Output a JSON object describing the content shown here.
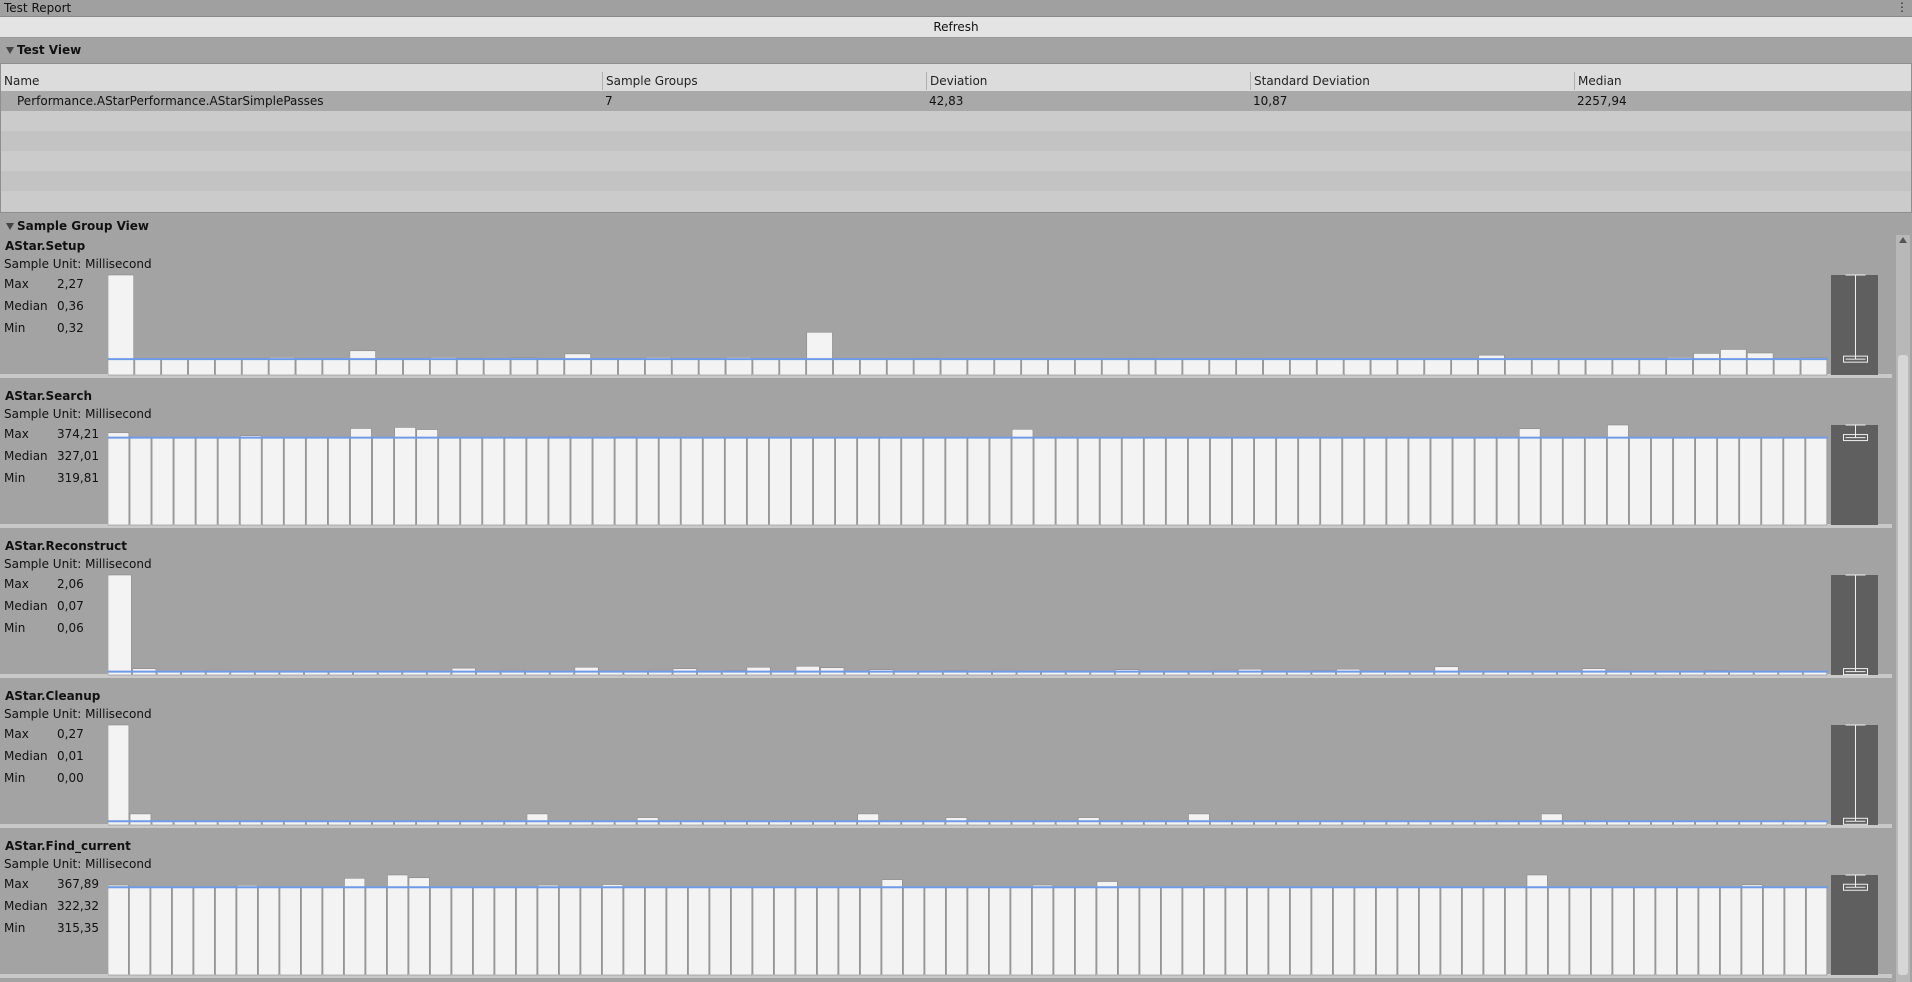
{
  "window": {
    "title": "Test Report",
    "menu_glyph": "⋮"
  },
  "toolbar": {
    "refresh_label": "Refresh"
  },
  "test_view": {
    "header": "Test View",
    "columns": [
      "Name",
      "Sample Groups",
      "Deviation",
      "Standard Deviation",
      "Median"
    ],
    "rows": [
      {
        "name": "Performance.AStarPerformance.AStarSimplePasses",
        "sample_groups": "7",
        "deviation": "42,83",
        "std_dev": "10,87",
        "median": "2257,94"
      }
    ]
  },
  "sample_group_view": {
    "header": "Sample Group View",
    "groups": [
      {
        "name": "AStar.Setup",
        "unit": "Sample Unit: Millisecond",
        "labels": [
          "Max",
          "Median",
          "Min"
        ],
        "max": "2,27",
        "median": "0,36",
        "min": "0,32",
        "values": [
          2.27,
          0.36,
          0.36,
          0.36,
          0.36,
          0.36,
          0.4,
          0.36,
          0.36,
          0.55,
          0.36,
          0.36,
          0.4,
          0.38,
          0.36,
          0.39,
          0.37,
          0.48,
          0.36,
          0.36,
          0.4,
          0.36,
          0.36,
          0.4,
          0.36,
          0.36,
          0.97,
          0.36,
          0.36,
          0.37,
          0.38,
          0.36,
          0.36,
          0.36,
          0.36,
          0.36,
          0.36,
          0.37,
          0.38,
          0.36,
          0.36,
          0.36,
          0.37,
          0.36,
          0.36,
          0.36,
          0.36,
          0.36,
          0.36,
          0.36,
          0.36,
          0.45,
          0.36,
          0.36,
          0.36,
          0.36,
          0.36,
          0.36,
          0.4,
          0.49,
          0.58,
          0.5,
          0.36,
          0.39
        ]
      },
      {
        "name": "AStar.Search",
        "unit": "Sample Unit: Millisecond",
        "labels": [
          "Max",
          "Median",
          "Min"
        ],
        "max": "374,21",
        "median": "327,01",
        "min": "319,81",
        "values": [
          345,
          327,
          327,
          327,
          327,
          327,
          334,
          327,
          327,
          327,
          327,
          361,
          327,
          365,
          357,
          327,
          327,
          327,
          327,
          327,
          332,
          327,
          327,
          330,
          327,
          327,
          327,
          327,
          327,
          327,
          327,
          327,
          327,
          327,
          327,
          327,
          327,
          327,
          327,
          327,
          327,
          358,
          327,
          327,
          327,
          327,
          327,
          327,
          327,
          327,
          327,
          327,
          327,
          327,
          327,
          327,
          327,
          327,
          327,
          327,
          327,
          327,
          327,
          327,
          360,
          327,
          327,
          327,
          374,
          327,
          327,
          327,
          327,
          327,
          327,
          327,
          327,
          327
        ]
      },
      {
        "name": "AStar.Reconstruct",
        "unit": "Sample Unit: Millisecond",
        "labels": [
          "Max",
          "Median",
          "Min"
        ],
        "max": "2,06",
        "median": "0,07",
        "min": "0,06",
        "values": [
          2.06,
          0.13,
          0.07,
          0.07,
          0.1,
          0.07,
          0.08,
          0.08,
          0.07,
          0.07,
          0.07,
          0.07,
          0.08,
          0.07,
          0.14,
          0.07,
          0.1,
          0.07,
          0.07,
          0.16,
          0.08,
          0.07,
          0.1,
          0.13,
          0.07,
          0.09,
          0.16,
          0.07,
          0.18,
          0.15,
          0.07,
          0.11,
          0.07,
          0.07,
          0.09,
          0.07,
          0.1,
          0.07,
          0.07,
          0.08,
          0.07,
          0.11,
          0.07,
          0.07,
          0.07,
          0.1,
          0.12,
          0.07,
          0.07,
          0.09,
          0.12,
          0.07,
          0.07,
          0.07,
          0.17,
          0.07,
          0.07,
          0.07,
          0.07,
          0.07,
          0.13,
          0.1,
          0.07,
          0.07,
          0.07,
          0.09,
          0.07,
          0.07,
          0.07,
          0.07
        ]
      },
      {
        "name": "AStar.Cleanup",
        "unit": "Sample Unit: Millisecond",
        "labels": [
          "Max",
          "Median",
          "Min"
        ],
        "max": "0,27",
        "median": "0,01",
        "min": "0,00",
        "values": [
          0.27,
          0.03,
          0.01,
          0.01,
          0.01,
          0.01,
          0.01,
          0.01,
          0.01,
          0.01,
          0.01,
          0.01,
          0.01,
          0.01,
          0.01,
          0.01,
          0.01,
          0.01,
          0.01,
          0.03,
          0.01,
          0.01,
          0.01,
          0.01,
          0.02,
          0.01,
          0.01,
          0.01,
          0.01,
          0.01,
          0.01,
          0.01,
          0.01,
          0.01,
          0.03,
          0.01,
          0.01,
          0.01,
          0.02,
          0.01,
          0.01,
          0.01,
          0.01,
          0.01,
          0.02,
          0.01,
          0.01,
          0.01,
          0.01,
          0.03,
          0.01,
          0.01,
          0.01,
          0.01,
          0.01,
          0.01,
          0.01,
          0.01,
          0.01,
          0.01,
          0.01,
          0.01,
          0.01,
          0.01,
          0.01,
          0.03,
          0.01,
          0.01,
          0.01,
          0.01,
          0.01,
          0.01,
          0.01,
          0.01,
          0.01,
          0.01,
          0.01,
          0.01
        ]
      },
      {
        "name": "AStar.Find_current",
        "unit": "Sample Unit: Millisecond",
        "labels": [
          "Max",
          "Median",
          "Min"
        ],
        "max": "367,89",
        "median": "322,32",
        "min": "315,35",
        "values": [
          330,
          322,
          322,
          322,
          322,
          322,
          329,
          322,
          322,
          322,
          322,
          355,
          322,
          367,
          357,
          322,
          322,
          322,
          322,
          322,
          330,
          322,
          322,
          332,
          322,
          322,
          322,
          322,
          322,
          322,
          322,
          322,
          322,
          322,
          322,
          322,
          350,
          322,
          322,
          322,
          322,
          322,
          322,
          330,
          322,
          322,
          343,
          322,
          322,
          322,
          322,
          327,
          322,
          322,
          322,
          322,
          322,
          322,
          322,
          322,
          322,
          322,
          322,
          322,
          322,
          322,
          367,
          322,
          322,
          322,
          322,
          322,
          322,
          322,
          322,
          322,
          331,
          322,
          322,
          322
        ]
      }
    ]
  },
  "colors": {
    "bar": "#f3f3f3",
    "bar_border": "#8a8a8a",
    "median_line": "#6f9ae8",
    "box_bg": "#5f5f5f",
    "box_line": "#f0f0f0",
    "panel_bg": "#a3a3a3"
  }
}
